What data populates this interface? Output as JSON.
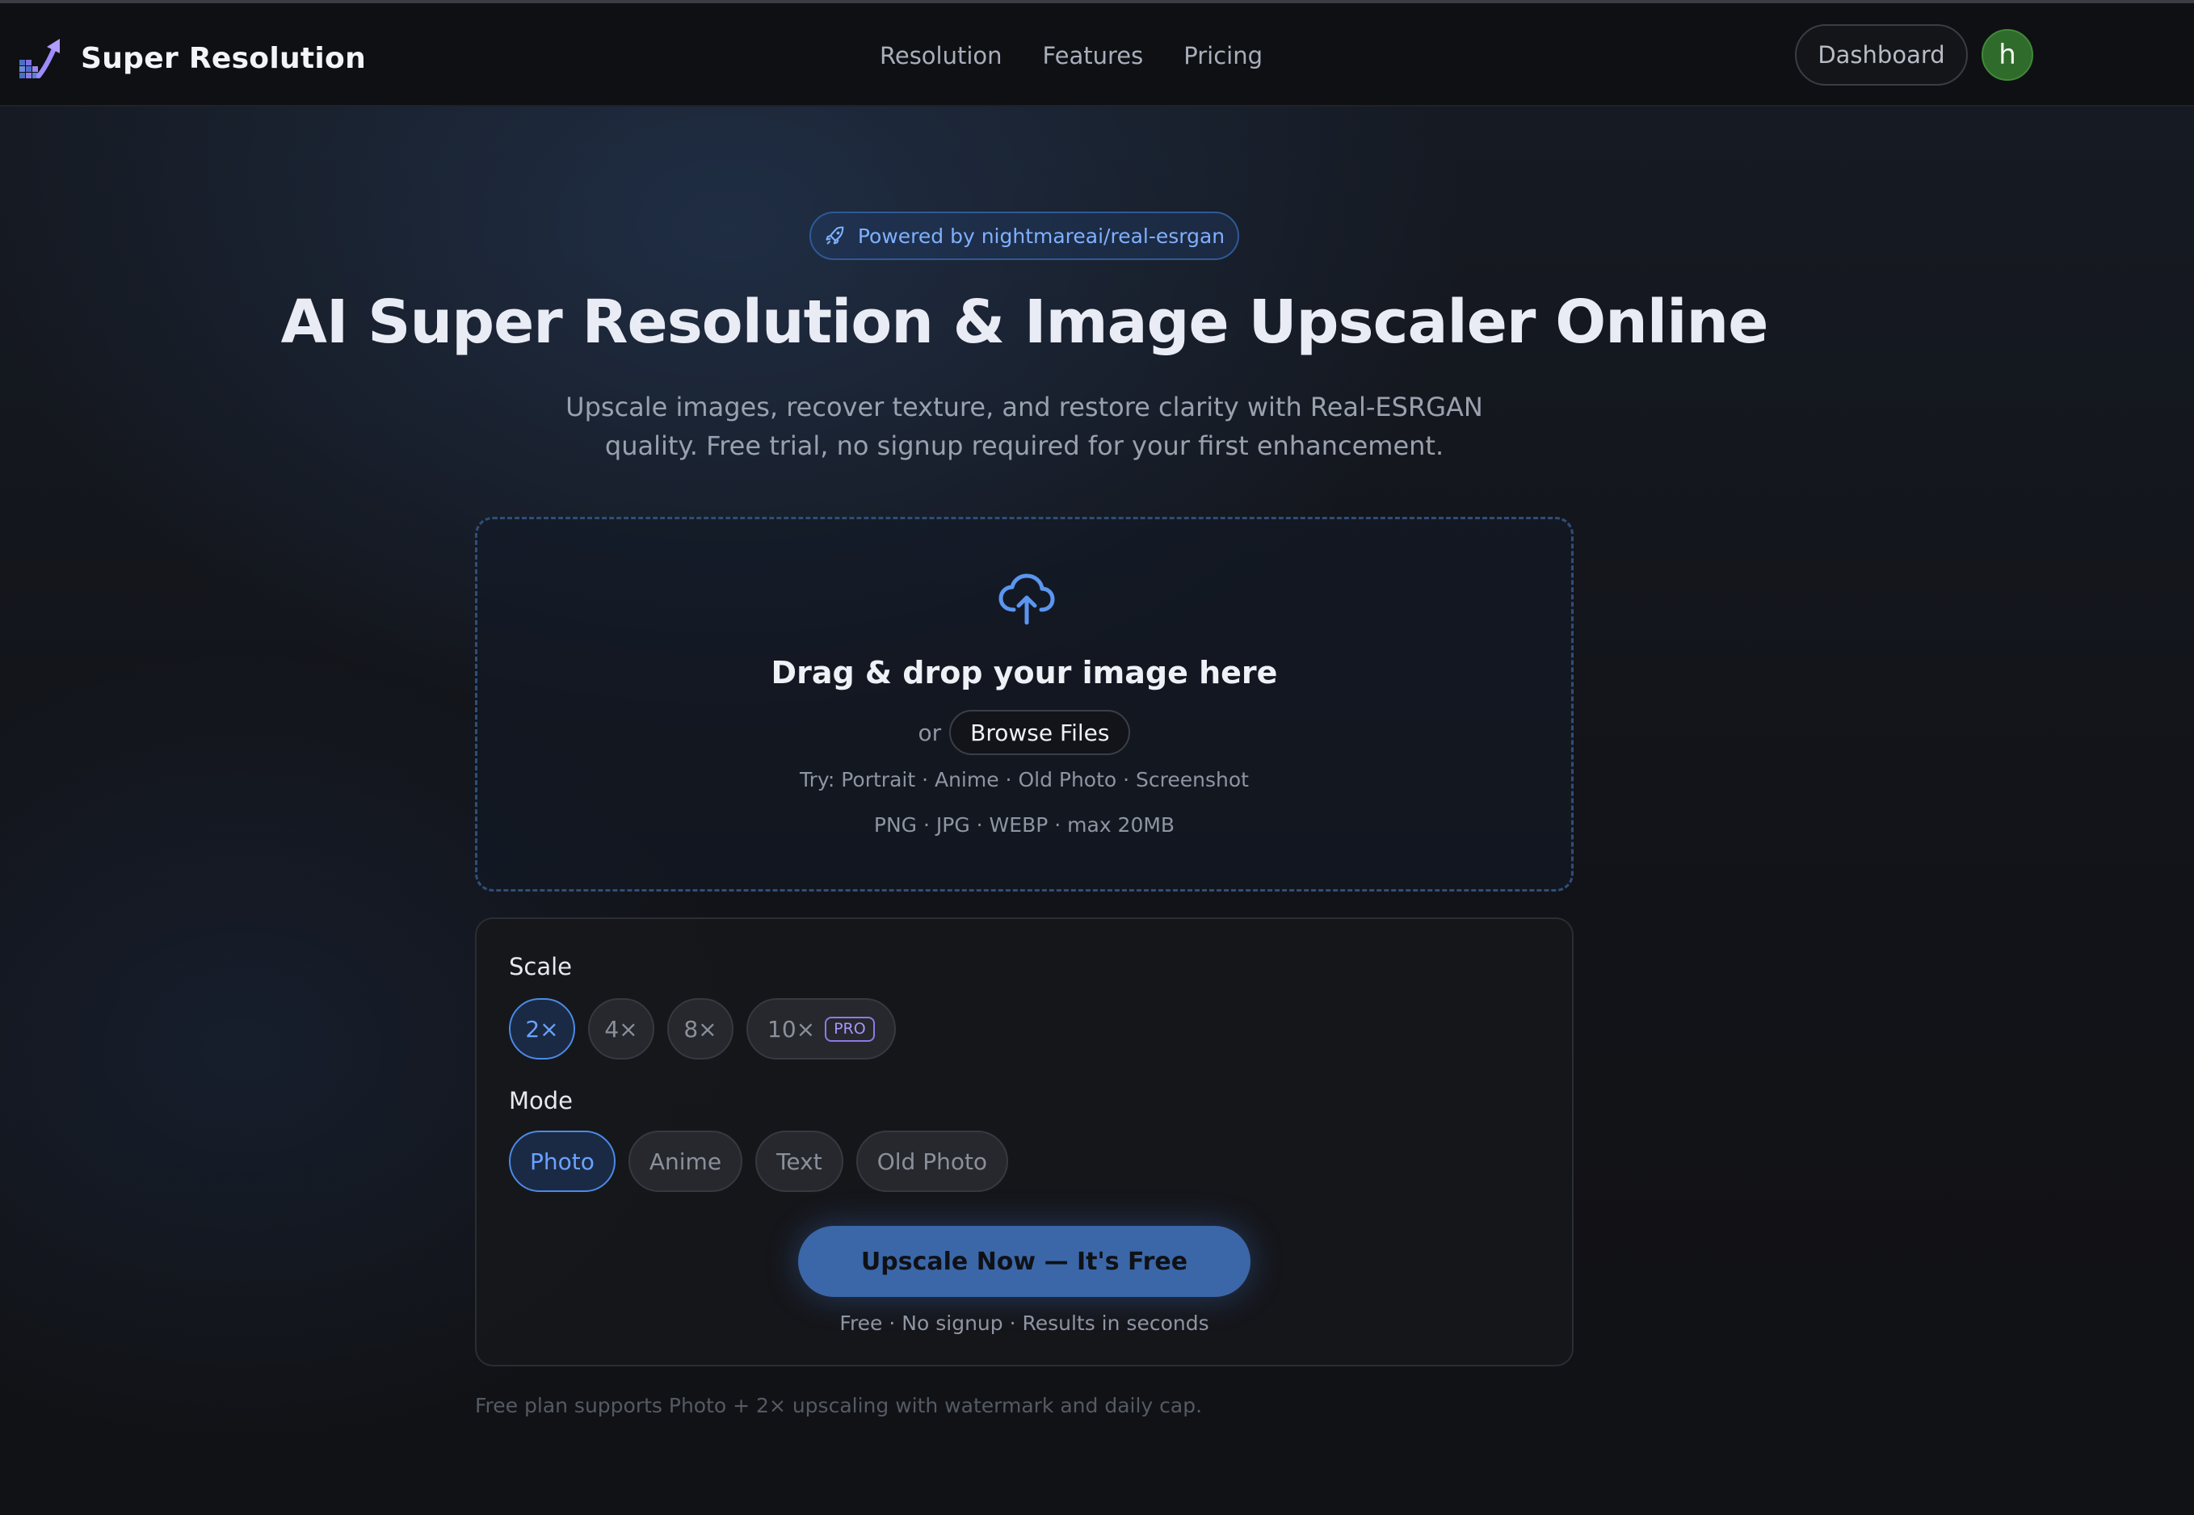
{
  "header": {
    "brand": "Super Resolution",
    "nav": [
      "Resolution",
      "Features",
      "Pricing"
    ],
    "dashboard_label": "Dashboard",
    "avatar_initial": "h"
  },
  "hero": {
    "badge": "Powered by nightmareai/real-esrgan",
    "title": "AI Super Resolution & Image Upscaler Online",
    "subtitle_line1": "Upscale images, recover texture, and restore clarity with Real-ESRGAN",
    "subtitle_line2": "quality. Free trial, no signup required for your first enhancement."
  },
  "dropzone": {
    "title": "Drag & drop your image here",
    "or_text": "or",
    "browse_label": "Browse Files",
    "try_text": "Try: Portrait · Anime · Old Photo · Screenshot",
    "formats_text": "PNG · JPG · WEBP · max 20MB"
  },
  "options": {
    "scale_label": "Scale",
    "scales": [
      "2×",
      "4×",
      "8×",
      "10×"
    ],
    "pro_tag": "PRO",
    "selected_scale": "2×",
    "mode_label": "Mode",
    "modes": [
      "Photo",
      "Anime",
      "Text",
      "Old Photo"
    ],
    "selected_mode": "Photo",
    "upscale_label": "Upscale Now — It's Free",
    "upscale_note": "Free · No signup · Results in seconds"
  },
  "footnote": "Free plan supports Photo + 2× upscaling with watermark and daily cap.",
  "colors": {
    "accent": "#4b8ae8",
    "button": "#3b67a8",
    "pro": "#8f78e6",
    "avatar": "#2f6b2a"
  },
  "icons": {
    "logo": "upscale-arrow-logo",
    "badge": "rocket-icon",
    "dropzone": "cloud-upload-icon"
  }
}
